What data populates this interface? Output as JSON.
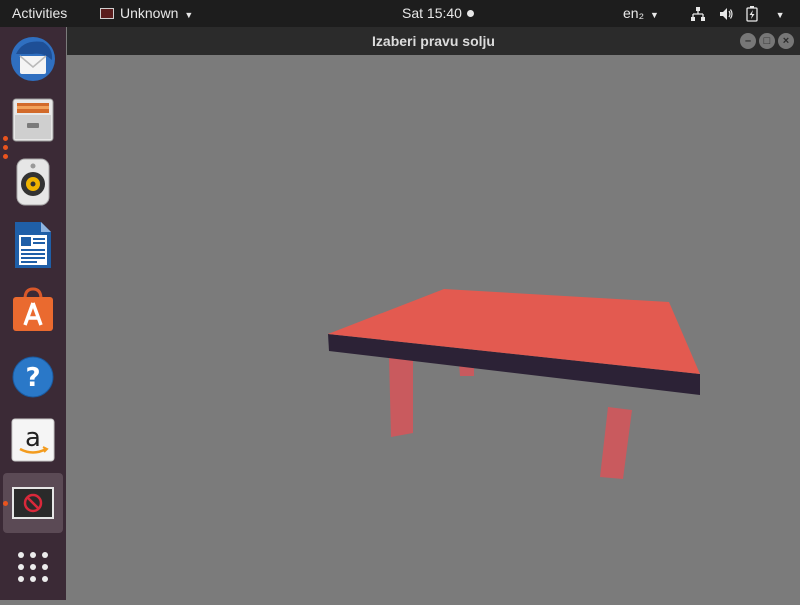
{
  "topbar": {
    "activities": "Activities",
    "app_name": "Unknown",
    "clock": "Sat 15:40",
    "lang": "en₂"
  },
  "dock": {
    "items": [
      {
        "name": "thunderbird-mail-icon"
      },
      {
        "name": "files-icon"
      },
      {
        "name": "rhythmbox-icon"
      },
      {
        "name": "libreoffice-writer-icon"
      },
      {
        "name": "ubuntu-software-icon"
      },
      {
        "name": "help-icon"
      },
      {
        "name": "amazon-icon"
      },
      {
        "name": "running-app-icon"
      },
      {
        "name": "show-applications-icon"
      }
    ]
  },
  "window": {
    "title": "Izaberi pravu solju"
  },
  "colors": {
    "table_top": "#e35a50",
    "table_edge": "#2c2236",
    "table_leg": "#c95a5e",
    "background": "#7b7b7b"
  }
}
